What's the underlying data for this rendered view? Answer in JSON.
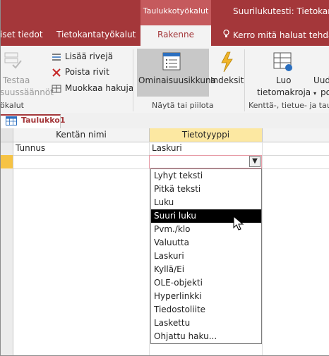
{
  "window": {
    "context_group": "Taulukkotyökalut",
    "document_title": "Suurilukutesti: Tietokanta"
  },
  "tabs": {
    "items": [
      "Ulkoiset tiedot",
      "Tietokantatyökalut",
      "Rakenne"
    ],
    "visible_text": [
      "iset tiedot",
      "Tietokantatyökalut"
    ],
    "active": "Rakenne",
    "tell_me": "Kerro mitä haluat tehdä"
  },
  "ribbon": {
    "test_line1": "Testaa",
    "test_line2": "suussäännöt",
    "tools_fragment": "ökalut",
    "insert_rows": "Lisää rivejä",
    "delete_rows": "Poista rivit",
    "modify_lookups": "Muokkaa hakuja",
    "property_sheet": "Ominaisuusikkuna",
    "indexes": "Indeksit",
    "show_hide": "Näytä tai piilota",
    "create_macros_line1": "Luo",
    "create_macros_line2": "tietomakroja",
    "rename_fragment1": "Uud",
    "rename_fragment2": "po",
    "field_events_group": "Kenttä-, tietue- ja taulu"
  },
  "document_tab": {
    "label": "Taulukko1"
  },
  "grid": {
    "col_field_name": "Kentän nimi",
    "col_data_type": "Tietotyyppi",
    "rows": [
      {
        "field_name": "Tunnus",
        "data_type": "Laskuri"
      },
      {
        "field_name": "",
        "data_type": ""
      }
    ]
  },
  "dropdown": {
    "selected": "Suuri luku",
    "options": [
      "Lyhyt teksti",
      "Pitkä teksti",
      "Luku",
      "Suuri luku",
      "Pvm./klo",
      "Valuutta",
      "Laskuri",
      "Kyllä/Ei",
      "OLE-objekti",
      "Hyperlinkki",
      "Tiedostoliite",
      "Laskettu",
      "Ohjattu haku..."
    ]
  },
  "colors": {
    "accent": "#a4373a",
    "header_highlight": "#fce8a2",
    "row_selector": "#f6c344"
  }
}
